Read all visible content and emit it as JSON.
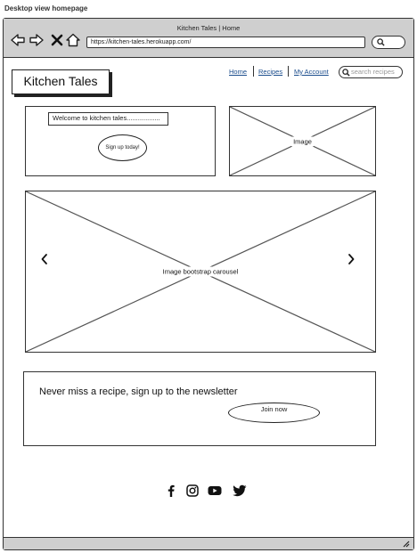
{
  "caption": "Desktop view homepage",
  "browser": {
    "title": "Kitchen Tales | Home",
    "url": "https://kitchen-tales.herokuapp.com/"
  },
  "header": {
    "logo": "Kitchen Tales",
    "nav": [
      "Home",
      "Recipes",
      "My Account"
    ],
    "search_placeholder": "search recipes"
  },
  "hero": {
    "welcome_text": "Welcome to kitchen tales..................",
    "signup_button": "Sign up today!",
    "image_label": "Image"
  },
  "carousel": {
    "label": "Image bootstrap carousel",
    "prev_icon": "chevron-left-icon",
    "next_icon": "chevron-right-icon"
  },
  "newsletter": {
    "text": "Never miss a recipe, sign up to the newsletter",
    "join_button": "Join now"
  },
  "footer": {
    "icons": [
      "facebook-icon",
      "instagram-icon",
      "youtube-icon",
      "twitter-icon"
    ]
  }
}
